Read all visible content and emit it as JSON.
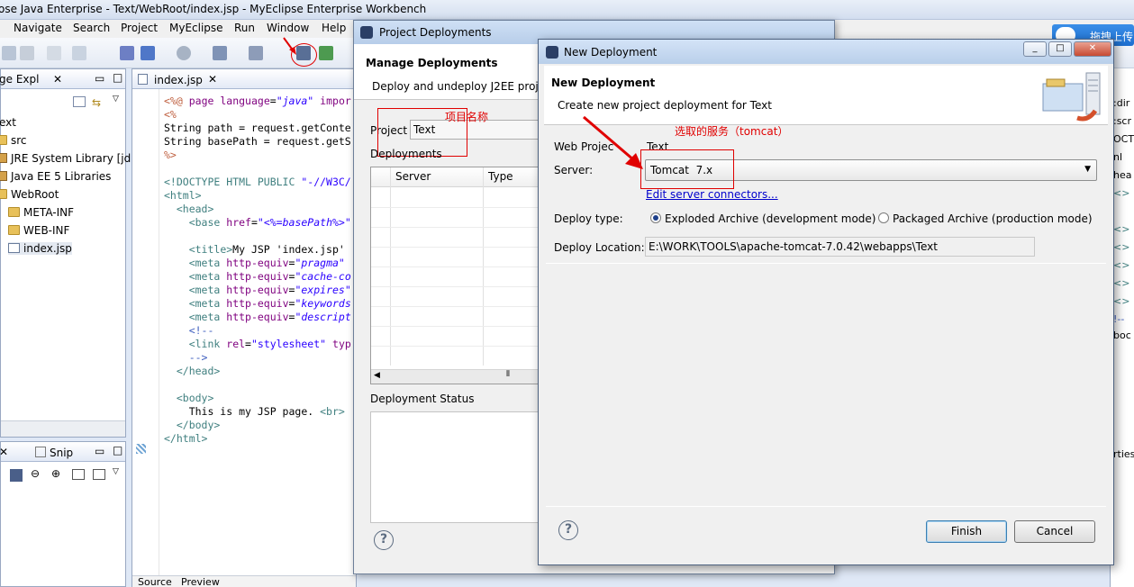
{
  "ide": {
    "window_title": "ose Java Enterprise - Text/WebRoot/index.jsp - MyEclipse Enterprise Workbench",
    "menu": [
      "Navigate",
      "Search",
      "Project",
      "MyEclipse",
      "Run",
      "Window",
      "Help"
    ],
    "package_explorer": {
      "tab_label": "ge Expl",
      "items": [
        "ext",
        "src",
        "JRE System Library [jdk",
        "Java EE 5 Libraries",
        "WebRoot",
        "META-INF",
        "WEB-INF",
        "index.jsp"
      ]
    },
    "snippets_tab_label": "Snip",
    "editor": {
      "tab_label": "index.jsp",
      "bottom_tabs": [
        "Source",
        "Preview"
      ]
    },
    "right_strip_fragments": [
      ":dir",
      ":scr",
      "OCTY",
      "nl",
      "hea",
      "<>",
      "<>",
      "<>",
      "<>",
      "<>",
      "<>",
      "!--",
      "boc",
      "rties"
    ],
    "upload_badge": "拖拽上传"
  },
  "project_deployments": {
    "title": "Project Deployments",
    "heading": "Manage Deployments",
    "subheading": "Deploy and undeploy J2EE proj",
    "project_label": "Project",
    "project_value": "Text",
    "project_annotation": "项目名称",
    "deployments_label": "Deployments",
    "columns": [
      "Server",
      "Type"
    ],
    "status_label": "Deployment Status",
    "help": "?"
  },
  "new_deployment": {
    "title": "New Deployment",
    "heading": "New Deployment",
    "subheading": "Create new project deployment for Text",
    "server_annotation": "选取的服务（tomcat）",
    "web_project_label": "Web Projec",
    "web_project_value": "Text",
    "server_label": "Server:",
    "server_value": "Tomcat  7.x",
    "edit_link": "Edit server connectors...",
    "deploy_type_label": "Deploy type:",
    "exploded_label": "Exploded Archive (development mode)",
    "packaged_label": "Packaged Archive (production mode)",
    "deploy_location_label": "Deploy Location:",
    "deploy_location_value": "E:\\WORK\\TOOLS\\apache-tomcat-7.0.42\\webapps\\Text",
    "finish_label": "Finish",
    "cancel_label": "Cancel",
    "help": "?"
  }
}
